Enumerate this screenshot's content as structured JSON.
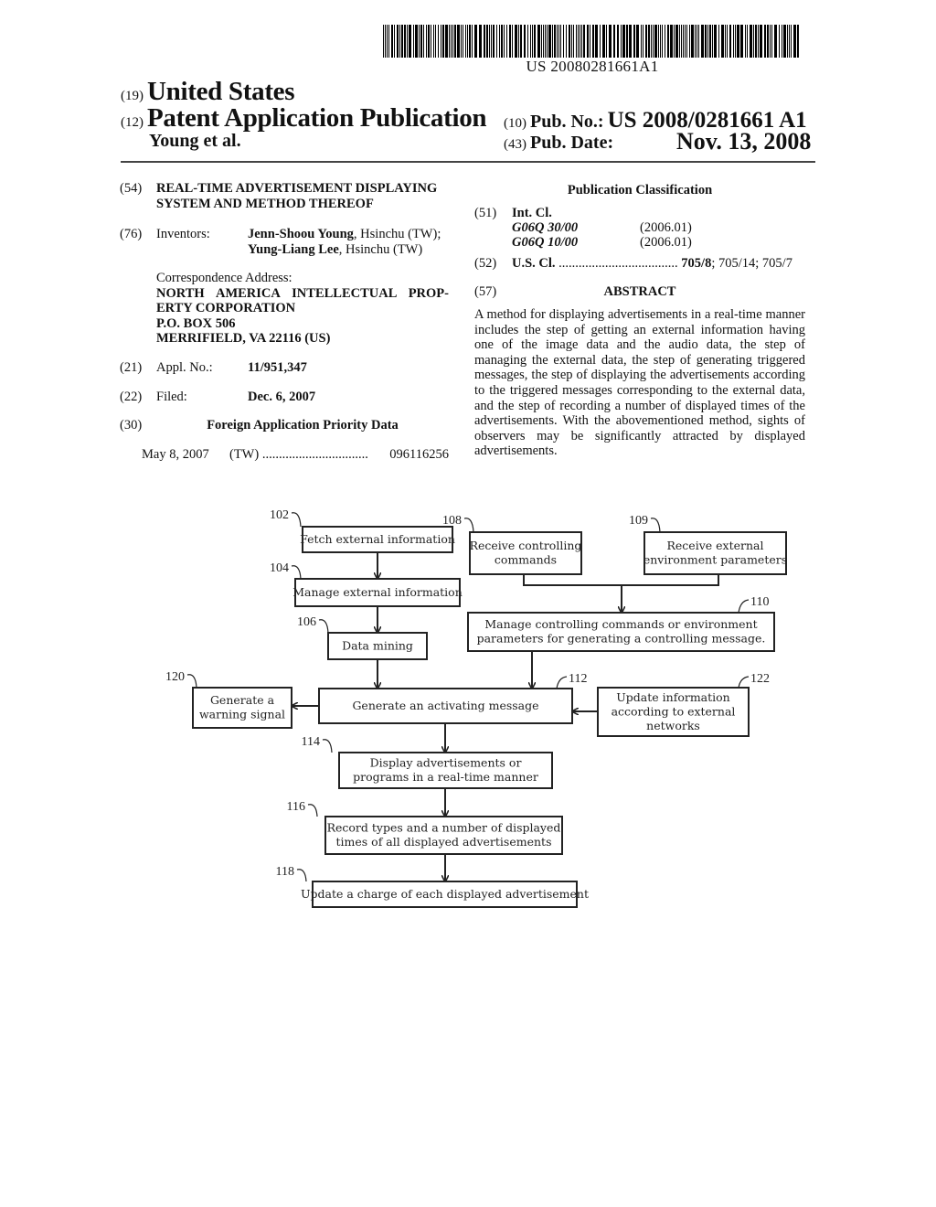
{
  "barcode": {
    "number": "US 20080281661A1"
  },
  "header": {
    "country_code": "(19)",
    "country": "United States",
    "type_code": "(12)",
    "type": "Patent Application Publication",
    "authors": "Young et al.",
    "pub_no_code": "(10)",
    "pub_no_label": "Pub. No.:",
    "pub_no": "US 2008/0281661 A1",
    "pub_date_code": "(43)",
    "pub_date_label": "Pub. Date:",
    "pub_date": "Nov. 13, 2008"
  },
  "left": {
    "title_code": "(54)",
    "title_line1": "REAL-TIME ADVERTISEMENT DISPLAYING",
    "title_line2": "SYSTEM AND METHOD THEREOF",
    "inventors_code": "(76)",
    "inventors_label": "Inventors:",
    "inventor1_name": "Jenn-Shoou Young",
    "inventor1_loc": ", Hsinchu (TW);",
    "inventor2_name": "Yung-Liang Lee",
    "inventor2_loc": ", Hsinchu (TW)",
    "corr_label": "Correspondence Address:",
    "corr_line1": "NORTH AMERICA INTELLECTUAL PROP-",
    "corr_line2": "ERTY CORPORATION",
    "corr_line3": "P.O. BOX 506",
    "corr_line4": "MERRIFIELD, VA 22116 (US)",
    "appl_code": "(21)",
    "appl_label": "Appl. No.:",
    "appl_no": "11/951,347",
    "filed_code": "(22)",
    "filed_label": "Filed:",
    "filed_date": "Dec. 6, 2007",
    "foreign_code": "(30)",
    "foreign_title": "Foreign Application Priority Data",
    "foreign_date": "May 8, 2007",
    "foreign_country": "(TW)",
    "foreign_dots": "................................",
    "foreign_no": "096116256"
  },
  "right": {
    "class_title": "Publication Classification",
    "intcl_code": "(51)",
    "intcl_label": "Int. Cl.",
    "intcl": [
      {
        "code": "G06Q 30/00",
        "version": "(2006.01)"
      },
      {
        "code": "G06Q 10/00",
        "version": "(2006.01)"
      }
    ],
    "uscl_code": "(52)",
    "uscl_label": "U.S. Cl.",
    "uscl_dots": "....................................",
    "uscl_primary": "705/8",
    "uscl_rest": "; 705/14; 705/7",
    "abstract_code": "(57)",
    "abstract_title": "ABSTRACT",
    "abstract_text": "A method for displaying advertisements in a real-time manner includes the step of getting an external information having one of the image data and the audio data, the step of managing the external data, the step of generating triggered messages, the step of displaying the advertisements according to the triggered messages corresponding to the external data, and the step of recording a number of displayed times of the advertisements. With the abovementioned method, sights of observers may be significantly attracted by displayed advertisements."
  },
  "diagram": {
    "nodes": {
      "n102": {
        "ref": "102",
        "lines": [
          "Fetch external information"
        ]
      },
      "n104": {
        "ref": "104",
        "lines": [
          "Manage external information"
        ]
      },
      "n106": {
        "ref": "106",
        "lines": [
          "Data mining"
        ]
      },
      "n108": {
        "ref": "108",
        "lines": [
          "Receive controlling",
          "commands"
        ]
      },
      "n109": {
        "ref": "109",
        "lines": [
          "Receive external",
          "environment parameters"
        ]
      },
      "n110": {
        "ref": "110",
        "lines": [
          "Manage controlling commands or environment",
          "parameters for generating a controlling message."
        ]
      },
      "n112": {
        "ref": "112",
        "lines": [
          "Generate an activating message"
        ]
      },
      "n120": {
        "ref": "120",
        "lines": [
          "Generate a",
          "warning signal"
        ]
      },
      "n122": {
        "ref": "122",
        "lines": [
          "Update information",
          "according to external",
          "networks"
        ]
      },
      "n114": {
        "ref": "114",
        "lines": [
          "Display advertisements or",
          "programs in a real-time manner"
        ]
      },
      "n116": {
        "ref": "116",
        "lines": [
          "Record types and a number of displayed",
          "times of all displayed advertisements"
        ]
      },
      "n118": {
        "ref": "118",
        "lines": [
          "Update a charge of each displayed advertisement"
        ]
      }
    }
  }
}
